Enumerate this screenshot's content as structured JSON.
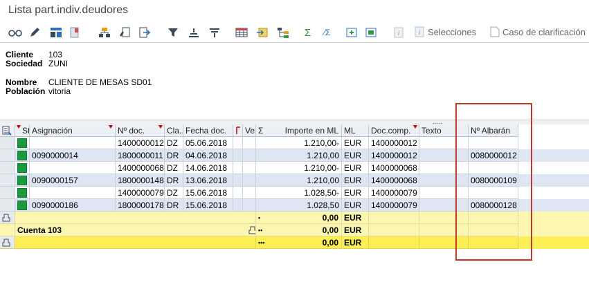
{
  "window": {
    "title": "Lista part.indiv.deudores"
  },
  "toolbar": {
    "selecciones_label": "Selecciones",
    "caso_label": "Caso de clarificación"
  },
  "header": {
    "cliente_label": "Cliente",
    "cliente_value": "103",
    "sociedad_label": "Sociedad",
    "sociedad_value": "ZUNI",
    "nombre_label": "Nombre",
    "nombre_value": "CLIENTE DE MESAS SD01",
    "poblacion_label": "Población",
    "poblacion_value": "vitoria"
  },
  "splitter": {
    "dots": "....."
  },
  "table": {
    "columns": {
      "st": "St",
      "asignacion": "Asignación",
      "ndoc": "Nº doc.",
      "clase": "Cla...",
      "fecha": "Fecha doc.",
      "ve": "Ve",
      "sigma": "Σ",
      "importe": "Importe en ML",
      "ml": "ML",
      "doccomp": "Doc.comp.",
      "texto": "Texto",
      "albaran": "Nº Albarán"
    },
    "rows": [
      {
        "asignacion": "",
        "ndoc": "1400000012",
        "clase": "DZ",
        "fecha": "05.06.2018",
        "importe": "1.210,00-",
        "ml": "EUR",
        "doccomp": "1400000012",
        "albaran": ""
      },
      {
        "asignacion": "0090000014",
        "ndoc": "1800000011",
        "clase": "DR",
        "fecha": "04.06.2018",
        "importe": "1.210,00",
        "ml": "EUR",
        "doccomp": "1400000012",
        "albaran": "0080000012"
      },
      {
        "asignacion": "",
        "ndoc": "1400000068",
        "clase": "DZ",
        "fecha": "14.06.2018",
        "importe": "1.210,00-",
        "ml": "EUR",
        "doccomp": "1400000068",
        "albaran": ""
      },
      {
        "asignacion": "0090000157",
        "ndoc": "1800000148",
        "clase": "DR",
        "fecha": "13.06.2018",
        "importe": "1.210,00",
        "ml": "EUR",
        "doccomp": "1400000068",
        "albaran": "0080000109"
      },
      {
        "asignacion": "",
        "ndoc": "1400000079",
        "clase": "DZ",
        "fecha": "15.06.2018",
        "importe": "1.028,50-",
        "ml": "EUR",
        "doccomp": "1400000079",
        "albaran": ""
      },
      {
        "asignacion": "0090000186",
        "ndoc": "1800000178",
        "clase": "DR",
        "fecha": "15.06.2018",
        "importe": "1.028,50",
        "ml": "EUR",
        "doccomp": "1400000079",
        "albaran": "0080000128"
      }
    ],
    "totals": [
      {
        "label": "",
        "marker": "•",
        "importe": "0,00",
        "ml": "EUR"
      },
      {
        "label": "Cuenta 103",
        "marker": "••",
        "importe": "0,00",
        "ml": "EUR"
      },
      {
        "label": "",
        "marker": "•••",
        "importe": "0,00",
        "ml": "EUR"
      }
    ]
  },
  "colors": {
    "highlight_box": "#c0392b",
    "status_green": "#1b9a3f",
    "subtotal_yellow": "#fdf6b0",
    "total_yellow": "#fbef55"
  }
}
